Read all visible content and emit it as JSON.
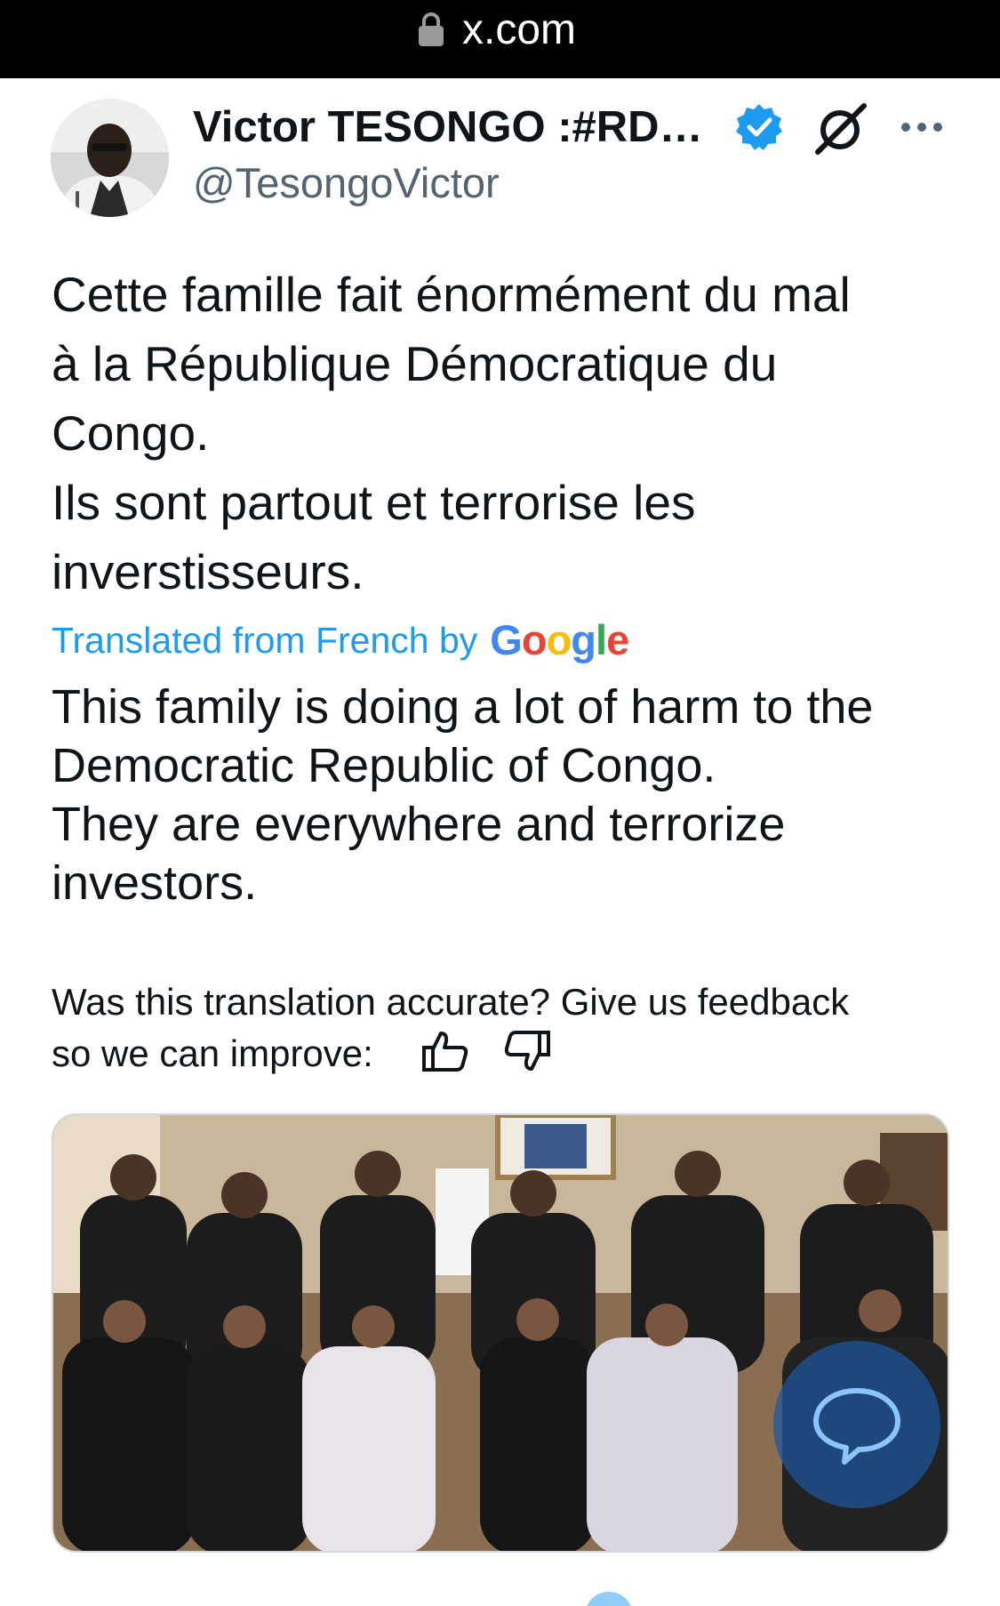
{
  "browser": {
    "url": "x.com",
    "lock_icon": "lock-icon"
  },
  "tweet": {
    "author_name": "Victor TESONGO :#RD…",
    "author_handle": "@TesongoVictor",
    "verified_icon": "verified-badge-icon",
    "grok_icon": "grok-icon",
    "more_icon": "more-options-icon",
    "original_lines": [
      "Cette famille fait énormément du mal",
      "à la République Démocratique du",
      "Congo.",
      "Ils sont partout et terrorise les",
      "inverstisseurs."
    ],
    "translation_label": "Translated from French by",
    "translation_provider": "Google",
    "translated_lines": [
      "This family is doing a lot of harm to the",
      "Democratic Republic of Congo.",
      "They are everywhere and terrorize",
      "investors."
    ],
    "feedback_line1": "Was this translation accurate? Give us feedback",
    "feedback_line2": "so we can improve:",
    "thumbs_up_icon": "thumbs-up-icon",
    "thumbs_down_icon": "thumbs-down-icon",
    "chat_icon": "chat-bubble-icon"
  },
  "colors": {
    "link_blue": "#1d9bf0",
    "secondary_text": "#536471",
    "primary_text": "#0f1419",
    "google_blue": "#4285f4",
    "google_red": "#ea4335",
    "google_yellow": "#fbbc05",
    "google_green": "#34a853"
  }
}
